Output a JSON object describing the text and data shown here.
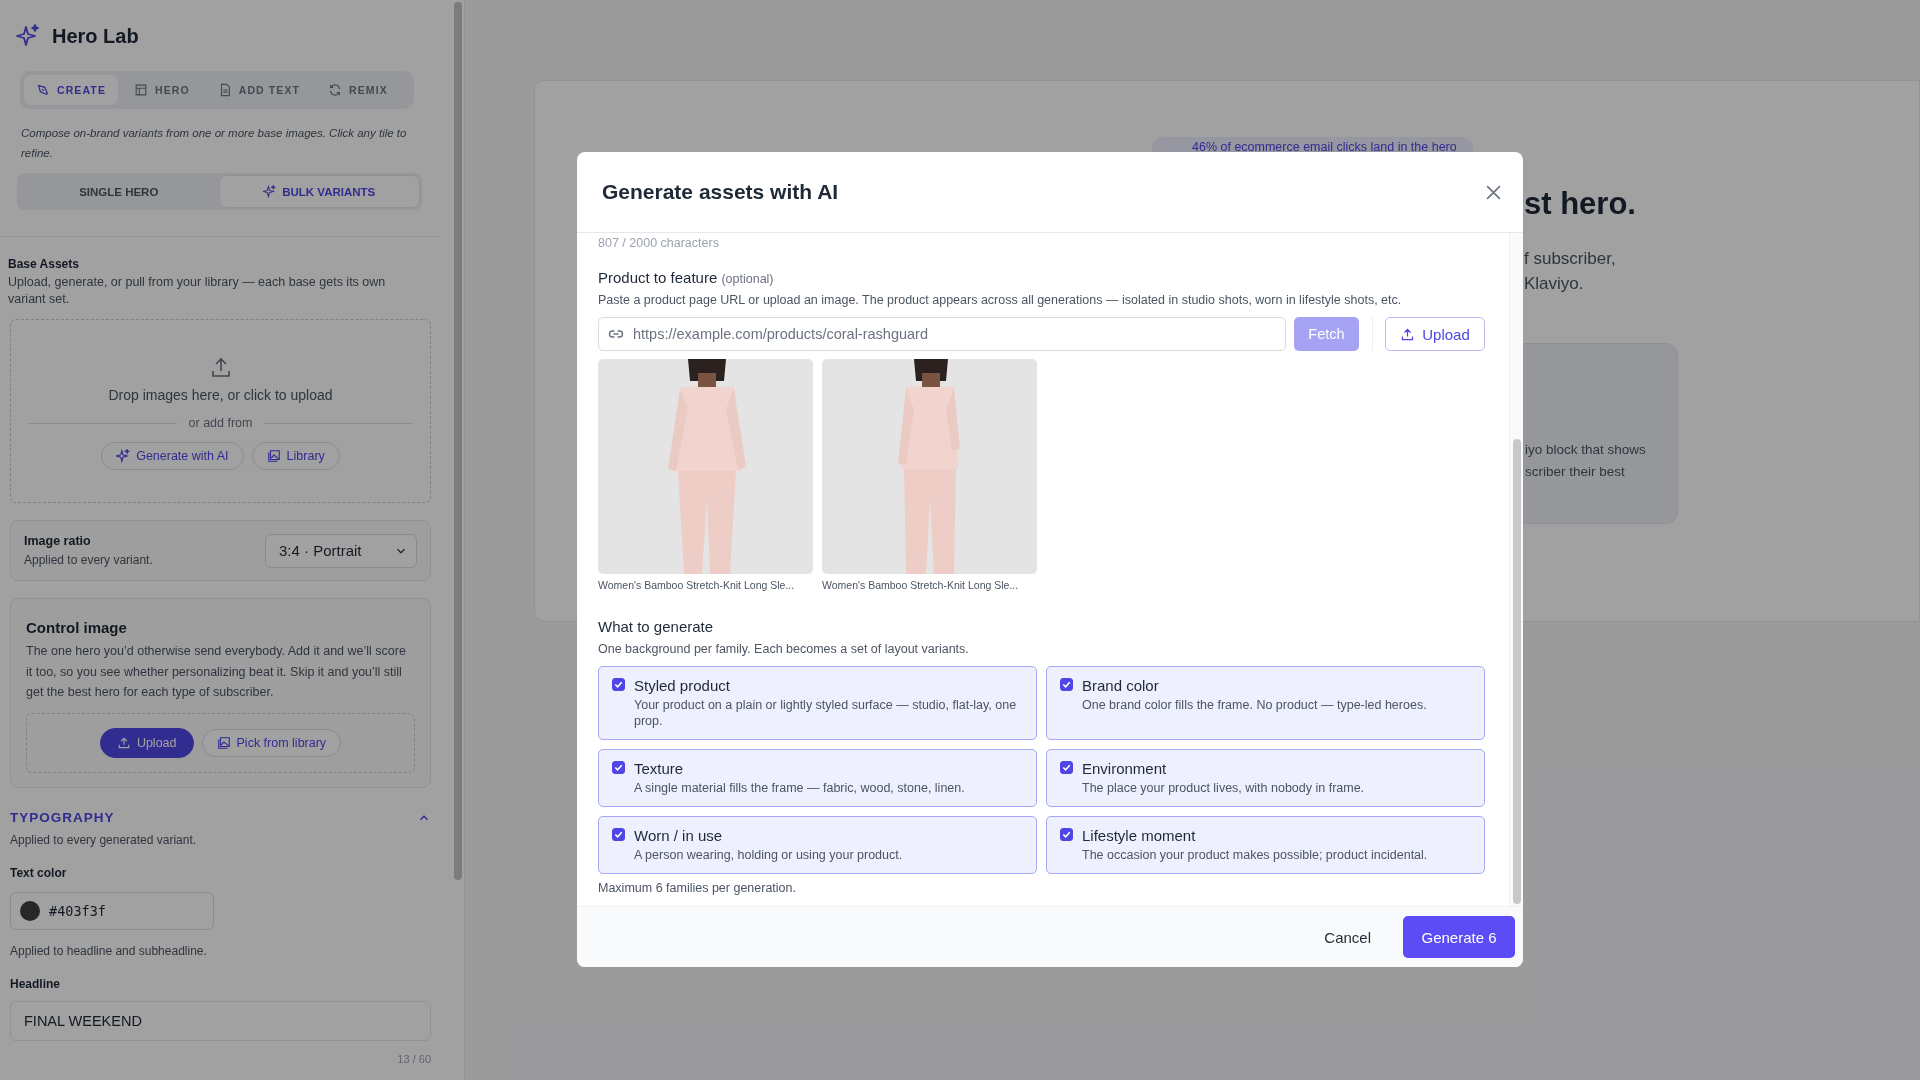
{
  "sidebar": {
    "app_title": "Hero Lab",
    "tabs": [
      {
        "label": "CREATE",
        "selected": true
      },
      {
        "label": "HERO",
        "selected": false
      },
      {
        "label": "ADD TEXT",
        "selected": false
      },
      {
        "label": "REMIX",
        "selected": false
      }
    ],
    "intro": "Compose on-brand variants from one or more base images. Click any tile to refine.",
    "modes": [
      {
        "label": "SINGLE HERO",
        "selected": false
      },
      {
        "label": "BULK VARIANTS",
        "selected": true
      }
    ],
    "base_assets": {
      "title": "Base Assets",
      "description": "Upload, generate, or pull from your library — each base gets its own variant set.",
      "drop_text": "Drop images here, or click to upload",
      "divider_text": "or add from",
      "buttons": [
        "Generate with AI",
        "Library"
      ]
    },
    "image_ratio": {
      "label": "Image ratio",
      "hint": "Applied to every variant.",
      "value": "3:4 · Portrait"
    },
    "control_image": {
      "title": "Control image",
      "description": "The one hero you’d otherwise send everybody. Add it and we’ll score it too, so you see whether personalizing beat it. Skip it and you’ll still get the best hero for each type of subscriber.",
      "upload_label": "Upload",
      "library_label": "Pick from library"
    },
    "typography": {
      "title": "TYPOGRAPHY",
      "expanded": true,
      "description": "Applied to every generated variant.",
      "text_color_label": "Text color",
      "text_color": "#403f3f",
      "text_color_hint": "Applied to headline and subheadline.",
      "headline_label": "Headline",
      "headline_value": "FINAL WEEKEND",
      "headline_count": "13 / 60"
    }
  },
  "background": {
    "badge": "46% of ecommerce email clicks land in the hero",
    "heading": "st hero.",
    "subtitle_lines": [
      "f subscriber,",
      "Klaviyo."
    ],
    "block_lines": [
      "iyo block that shows",
      "scriber their best"
    ]
  },
  "modal": {
    "title": "Generate assets with AI",
    "char_count": "807 / 2000 characters",
    "product": {
      "label": "Product to feature",
      "label_note": "(optional)",
      "description": "Paste a product page URL or upload an image. The product appears across all generations — isolated in studio shots, worn in lifestyle shots, etc.",
      "url_placeholder": "https://example.com/products/coral-rashguard",
      "fetch_label": "Fetch",
      "fetch_disabled": true,
      "upload_label": "Upload",
      "images": [
        {
          "kind": "picture",
          "caption": "Women's Bamboo Stretch-Knit Long Sle..."
        },
        {
          "kind": "picture",
          "caption": "Women's Bamboo Stretch-Knit Long Sle..."
        }
      ]
    },
    "generate": {
      "title": "What to generate",
      "description": "One background per family. Each becomes a set of layout variants.",
      "options": [
        {
          "title": "Styled product",
          "description": "Your product on a plain or lightly styled surface — studio, flat-lay, one prop.",
          "checked": true
        },
        {
          "title": "Brand color",
          "description": "One brand color fills the frame. No product — type-led heroes.",
          "checked": true
        },
        {
          "title": "Texture",
          "description": "A single material fills the frame — fabric, wood, stone, linen.",
          "checked": true
        },
        {
          "title": "Environment",
          "description": "The place your product lives, with nobody in frame.",
          "checked": true
        },
        {
          "title": "Worn / in use",
          "description": "A person wearing, holding or using your product.",
          "checked": true
        },
        {
          "title": "Lifestyle moment",
          "description": "The occasion your product makes possible; product incidental.",
          "checked": true
        }
      ],
      "note": "Maximum 6 families per generation."
    },
    "cancel_label": "Cancel",
    "submit_label": "Generate 6"
  }
}
